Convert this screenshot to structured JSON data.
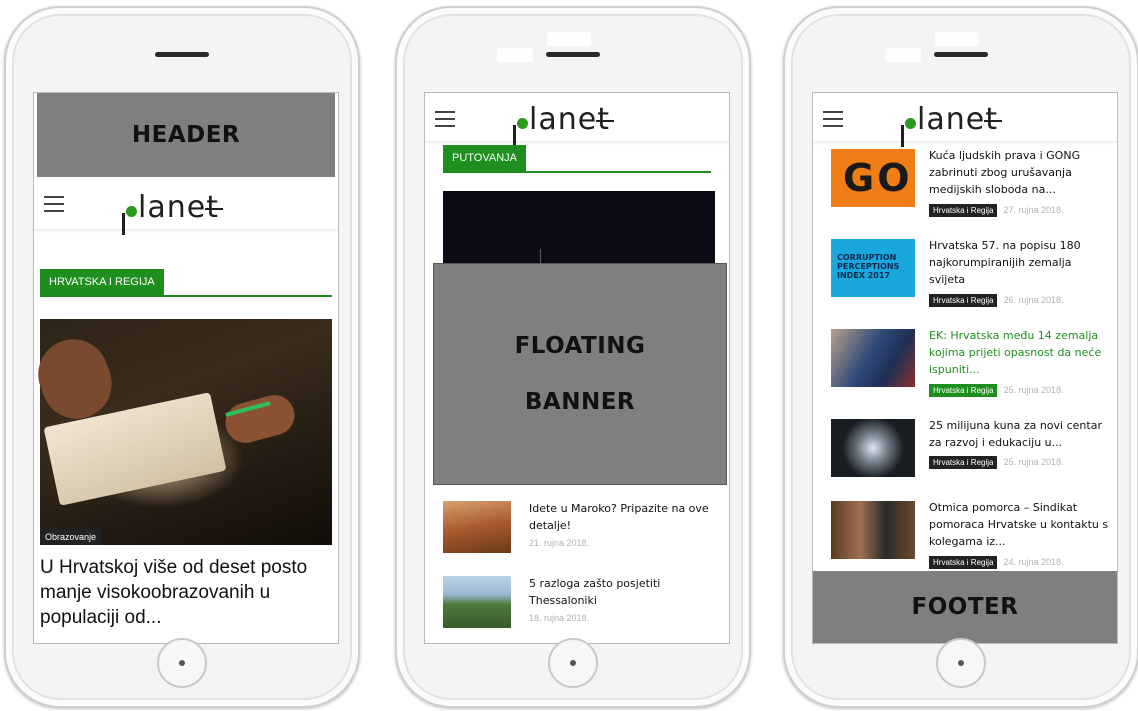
{
  "phones": [
    {
      "header_banner": "HEADER",
      "logo_text": "planet",
      "section": "HRVATSKA I REGIJA",
      "hero": {
        "category": "Obrazovanje",
        "title": "U Hrvatskoj više od deset posto manje visokoobrazovanih u populaciji od..."
      }
    },
    {
      "logo_text": "planet",
      "section": "PUTOVANJA",
      "floating_banner": [
        "FLOATING",
        "BANNER"
      ],
      "articles": [
        {
          "title": "Idete u Maroko? Pripazite na ove detalje!",
          "date": "21. rujna 2018."
        },
        {
          "title": "5 razloga zašto posjetiti Thessaloniki",
          "date": "18. rujna 2018."
        }
      ]
    },
    {
      "logo_text": "planet",
      "footer_banner": "FOOTER",
      "articles": [
        {
          "title": "Kuća ljudskih prava i GONG zabrinuti zbog urušavanja medijskih sloboda na...",
          "tag": "Hrvatska i Regija",
          "date": "27. rujna 2018.",
          "thumb_text": "GONG",
          "highlighted": false
        },
        {
          "title": "Hrvatska 57. na popisu 180 najkorumpiranijih zemalja svijeta",
          "tag": "Hrvatska i Regija",
          "date": "26. rujna 2018.",
          "thumb_text": "CORRUPTION PERCEPTIONS INDEX 2017",
          "highlighted": false
        },
        {
          "title": "EK: Hrvatska među 14 zemalja kojima prijeti opasnost da neće ispuniti...",
          "tag": "Hrvatska i Regija",
          "date": "25. rujna 2018.",
          "highlighted": true
        },
        {
          "title": "25 milijuna kuna za novi centar za razvoj i edukaciju u...",
          "tag": "Hrvatska i Regija",
          "date": "25. rujna 2018.",
          "highlighted": false
        },
        {
          "title": "Otmica pomorca – Sindikat pomoraca Hrvatske u kontaktu s kolegama iz...",
          "tag": "Hrvatska i Regija",
          "date": "24. rujna 2018.",
          "highlighted": false
        }
      ]
    }
  ],
  "colors": {
    "accent": "#1e8f1e",
    "placeholder_block": "#7f7f7f"
  },
  "icons": {
    "menu": "hamburger-icon",
    "home": "home-button"
  }
}
